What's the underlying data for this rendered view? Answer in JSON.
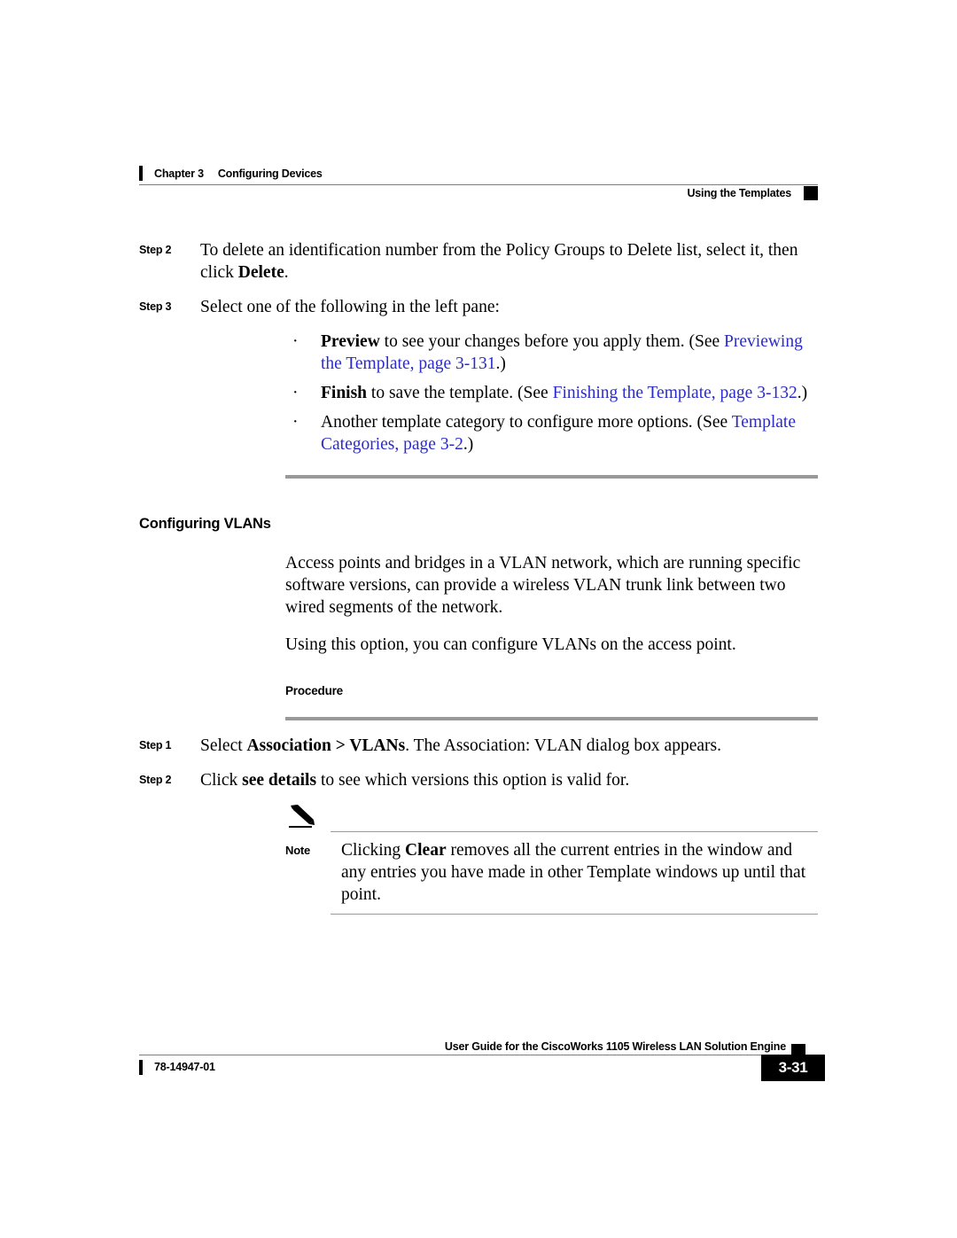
{
  "header": {
    "chapter": "Chapter 3",
    "chapter_title": "Configuring Devices",
    "section": "Using the Templates"
  },
  "steps_top": [
    {
      "label": "Step 2",
      "parts": [
        {
          "t": "To delete an identification number from the Policy Groups to Delete list, select it, then click ",
          "style": "plain"
        },
        {
          "t": "Delete",
          "style": "bold"
        },
        {
          "t": ".",
          "style": "plain"
        }
      ]
    },
    {
      "label": "Step 3",
      "parts": [
        {
          "t": "Select one of the following in the left pane:",
          "style": "plain"
        }
      ]
    }
  ],
  "bullets": [
    {
      "marker": "·",
      "parts": [
        {
          "t": "Preview",
          "style": "bold"
        },
        {
          "t": " to see your changes before you apply them. (See ",
          "style": "plain"
        },
        {
          "t": "Previewing the Template, page 3-131",
          "style": "link"
        },
        {
          "t": ".)",
          "style": "plain"
        }
      ]
    },
    {
      "marker": "·",
      "parts": [
        {
          "t": "Finish",
          "style": "bold"
        },
        {
          "t": " to save the template. (See ",
          "style": "plain"
        },
        {
          "t": "Finishing the Template, page 3-132",
          "style": "link"
        },
        {
          "t": ".)",
          "style": "plain"
        }
      ]
    },
    {
      "marker": "·",
      "parts": [
        {
          "t": "Another template category to configure more options. (See ",
          "style": "plain"
        },
        {
          "t": "Template Categories, page 3-2",
          "style": "link"
        },
        {
          "t": ".)",
          "style": "plain"
        }
      ]
    }
  ],
  "section": {
    "title": "Configuring VLANs",
    "paragraph1": "Access points and bridges in a VLAN network, which are running specific software versions, can provide a wireless VLAN trunk link between two wired segments of the network.",
    "paragraph2": "Using this option, you can configure VLANs on the access point.",
    "procedure_label": "Procedure"
  },
  "steps_proc": [
    {
      "label": "Step 1",
      "parts": [
        {
          "t": "Select ",
          "style": "plain"
        },
        {
          "t": "Association > VLANs",
          "style": "bold"
        },
        {
          "t": ". The Association: VLAN dialog box appears.",
          "style": "plain"
        }
      ]
    },
    {
      "label": "Step 2",
      "parts": [
        {
          "t": "Click ",
          "style": "plain"
        },
        {
          "t": "see details",
          "style": "bold"
        },
        {
          "t": " to see which versions this option is valid for.",
          "style": "plain"
        }
      ]
    }
  ],
  "note": {
    "label": "Note",
    "icon": "pencil-icon",
    "parts": [
      {
        "t": "Clicking ",
        "style": "plain"
      },
      {
        "t": "Clear",
        "style": "bold"
      },
      {
        "t": " removes all the current entries in the window and any entries you have made in other Template windows up until that point.",
        "style": "plain"
      }
    ]
  },
  "footer": {
    "title": "User Guide for the CiscoWorks 1105 Wireless LAN Solution Engine",
    "doc_number": "78-14947-01",
    "page_number": "3-31"
  },
  "colors": {
    "link": "#2b2bcc",
    "rule": "#999999",
    "header_rule": "#7d7d7d",
    "accent_black": "#000000"
  }
}
